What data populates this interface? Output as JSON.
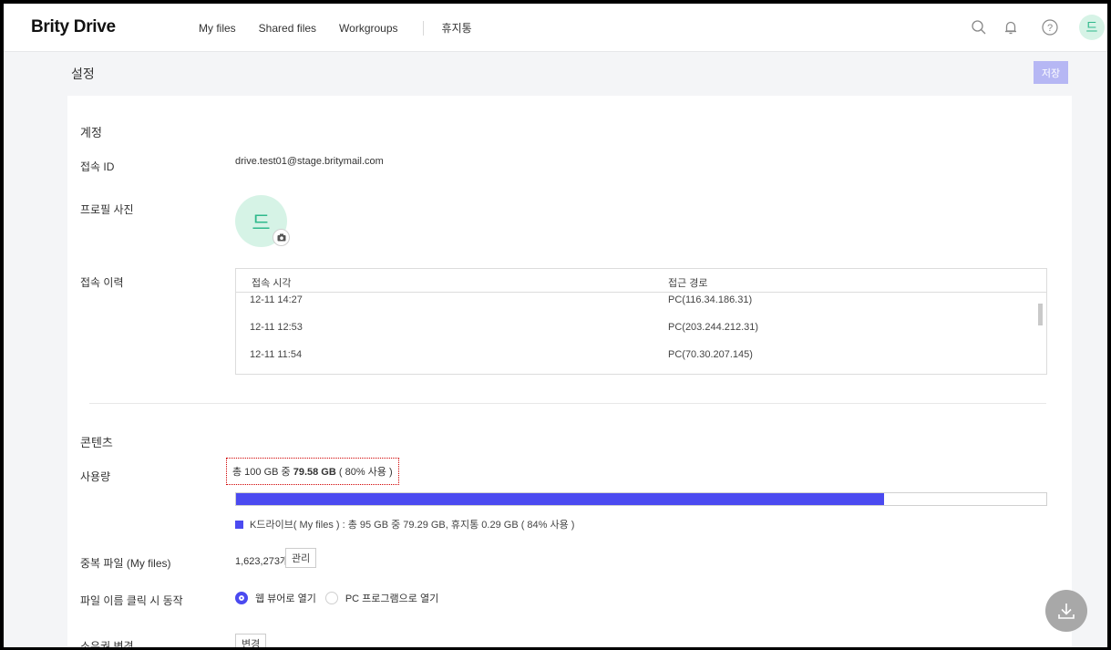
{
  "app": {
    "logo": "Brity Drive"
  },
  "nav": {
    "my_files": "My files",
    "shared_files": "Shared files",
    "workgroups": "Workgroups",
    "trash": "휴지통"
  },
  "header": {
    "avatar_initial": "드"
  },
  "page": {
    "title": "설정",
    "save_label": "저장"
  },
  "account": {
    "section_title": "계정",
    "id_label": "접속 ID",
    "id_value": "drive.test01@stage.britymail.com",
    "photo_label": "프로필 사진",
    "photo_initial": "드",
    "history_label": "접속 이력",
    "history_columns": [
      "접속 시각",
      "접근 경로"
    ],
    "history_rows": [
      {
        "time": "12-11 14:27",
        "route": "PC(116.34.186.31)"
      },
      {
        "time": "12-11 12:53",
        "route": "PC(203.244.212.31)"
      },
      {
        "time": "12-11 11:54",
        "route": "PC(70.30.207.145)"
      }
    ]
  },
  "content": {
    "section_title": "콘텐츠",
    "usage_label": "사용량",
    "usage_prefix": "총 100 GB 중 ",
    "usage_used": "79.58 GB",
    "usage_suffix": " ( 80% 사용 )",
    "usage_fraction": 0.8,
    "legend_text": "K드라이브( My files ) : 총 95 GB 중 79.29 GB,  휴지통 0.29 GB ( 84% 사용 )",
    "duplicate_label": "중복 파일 (My files)",
    "duplicate_count": "1,623,273개",
    "manage_label": "관리",
    "click_action_label": "파일 이름 클릭 시 동작",
    "option_web": "웹 뷰어로 열기",
    "option_pc": "PC 프로그램으로 열기",
    "owner_label": "소유권 변경",
    "change_label": "변경"
  },
  "colors": {
    "accent": "#4b4af0",
    "avatar_bg": "#d6f3e6",
    "avatar_fg": "#2fb98c",
    "save_bg": "#b6b7f4"
  }
}
